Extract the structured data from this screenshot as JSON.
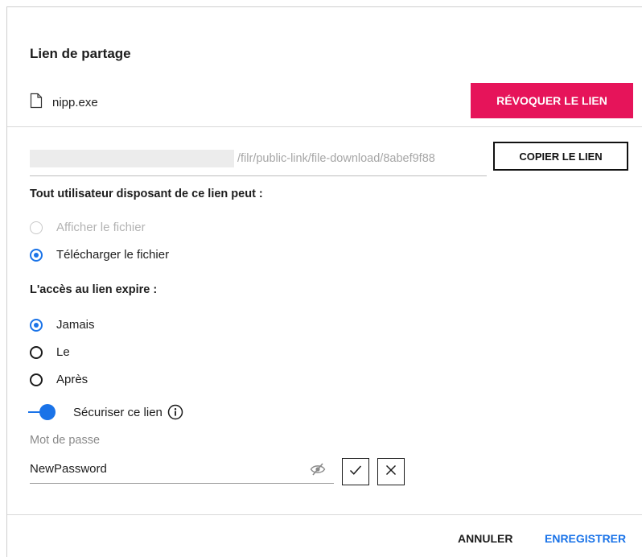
{
  "dialog": {
    "title": "Lien de partage",
    "file_name": "nipp.exe",
    "revoke_label": "RÉVOQUER LE LIEN"
  },
  "link": {
    "url_visible_part": "/filr/public-link/file-download/8abef9f88",
    "copy_label": "COPIER LE LIEN"
  },
  "permissions": {
    "heading": "Tout utilisateur disposant de ce lien peut :",
    "options": [
      {
        "label": "Afficher le fichier",
        "selected": false,
        "disabled": true
      },
      {
        "label": "Télécharger le fichier",
        "selected": true,
        "disabled": false
      }
    ]
  },
  "expiry": {
    "heading": "L'accès au lien expire :",
    "options": [
      {
        "label": "Jamais",
        "selected": true
      },
      {
        "label": "Le",
        "selected": false
      },
      {
        "label": "Après",
        "selected": false
      }
    ]
  },
  "secure": {
    "toggle_label": "Sécuriser ce lien",
    "enabled": true,
    "password_label": "Mot de passe",
    "password_value": "NewPassword"
  },
  "footer": {
    "cancel_label": "ANNULER",
    "save_label": "ENREGISTRER"
  },
  "colors": {
    "accent": "#1a73e8",
    "revoke": "#e6145a",
    "save_text": "#1a73e8"
  }
}
